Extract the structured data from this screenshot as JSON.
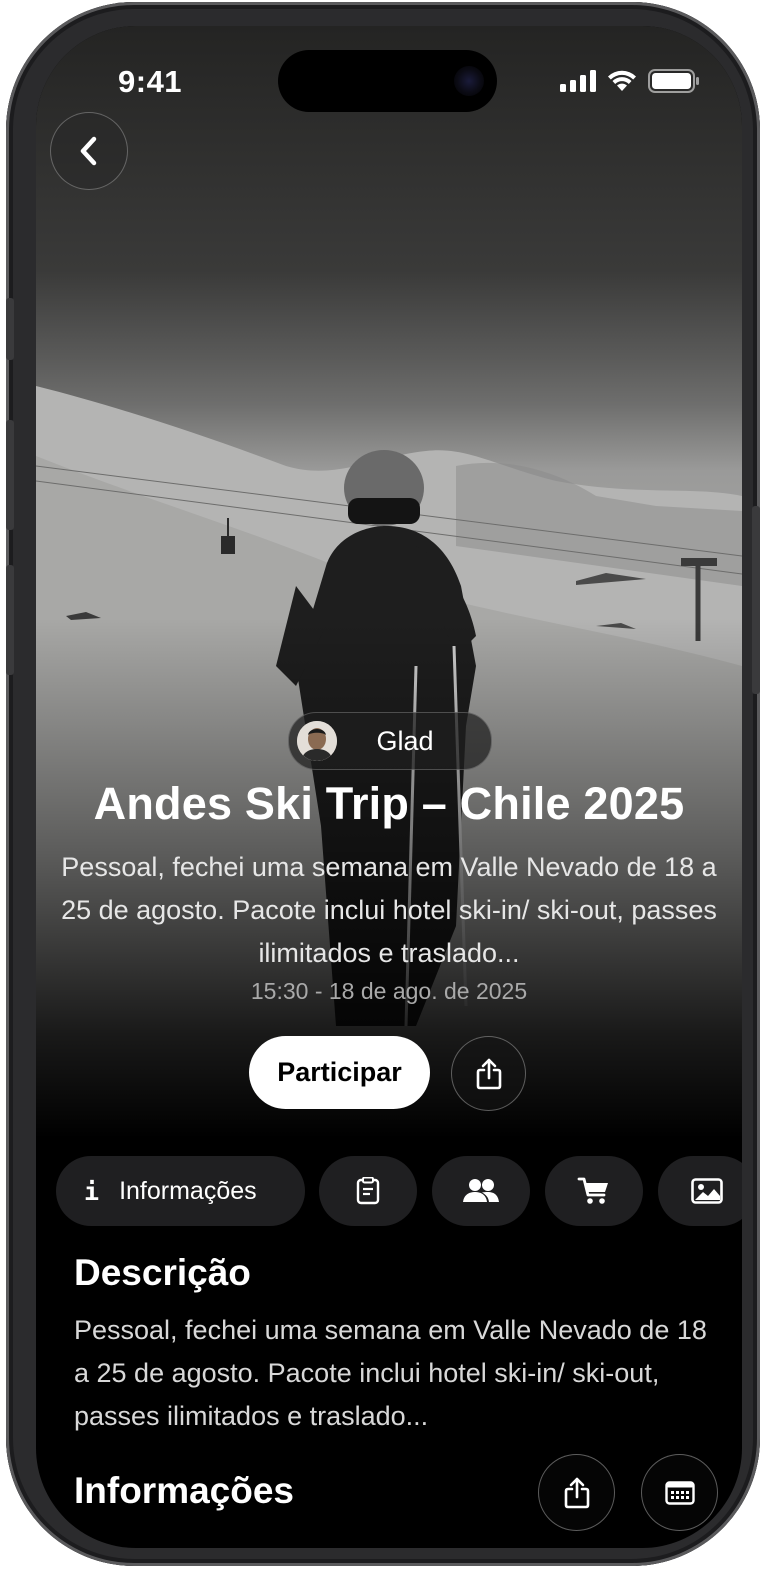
{
  "status_bar": {
    "time": "9:41"
  },
  "author": {
    "name": "Glad"
  },
  "event": {
    "title": "Andes Ski Trip – Chile 2025",
    "summary": "Pessoal, fechei uma semana em Valle Nevado de 18 a 25 de agosto. Pacote inclui hotel ski-in/ ski-out, passes ilimitados e traslado...",
    "datetime": "15:30 - 18 de ago. de 2025",
    "join_label": "Participar"
  },
  "tabs": {
    "info_glyph": "i",
    "info_label": "Informações",
    "icons": [
      "document-icon",
      "people-icon",
      "cart-icon",
      "gallery-icon"
    ]
  },
  "description": {
    "title": "Descrição",
    "body": "Pessoal, fechei uma semana em Valle Nevado de 18 a 25 de agosto. Pacote inclui hotel ski-in/ ski-out, passes ilimitados e traslado..."
  },
  "info": {
    "title": "Informações"
  },
  "colors": {
    "background": "#000000",
    "button_primary": "#ffffff",
    "tab_background": "#1f1f21"
  }
}
